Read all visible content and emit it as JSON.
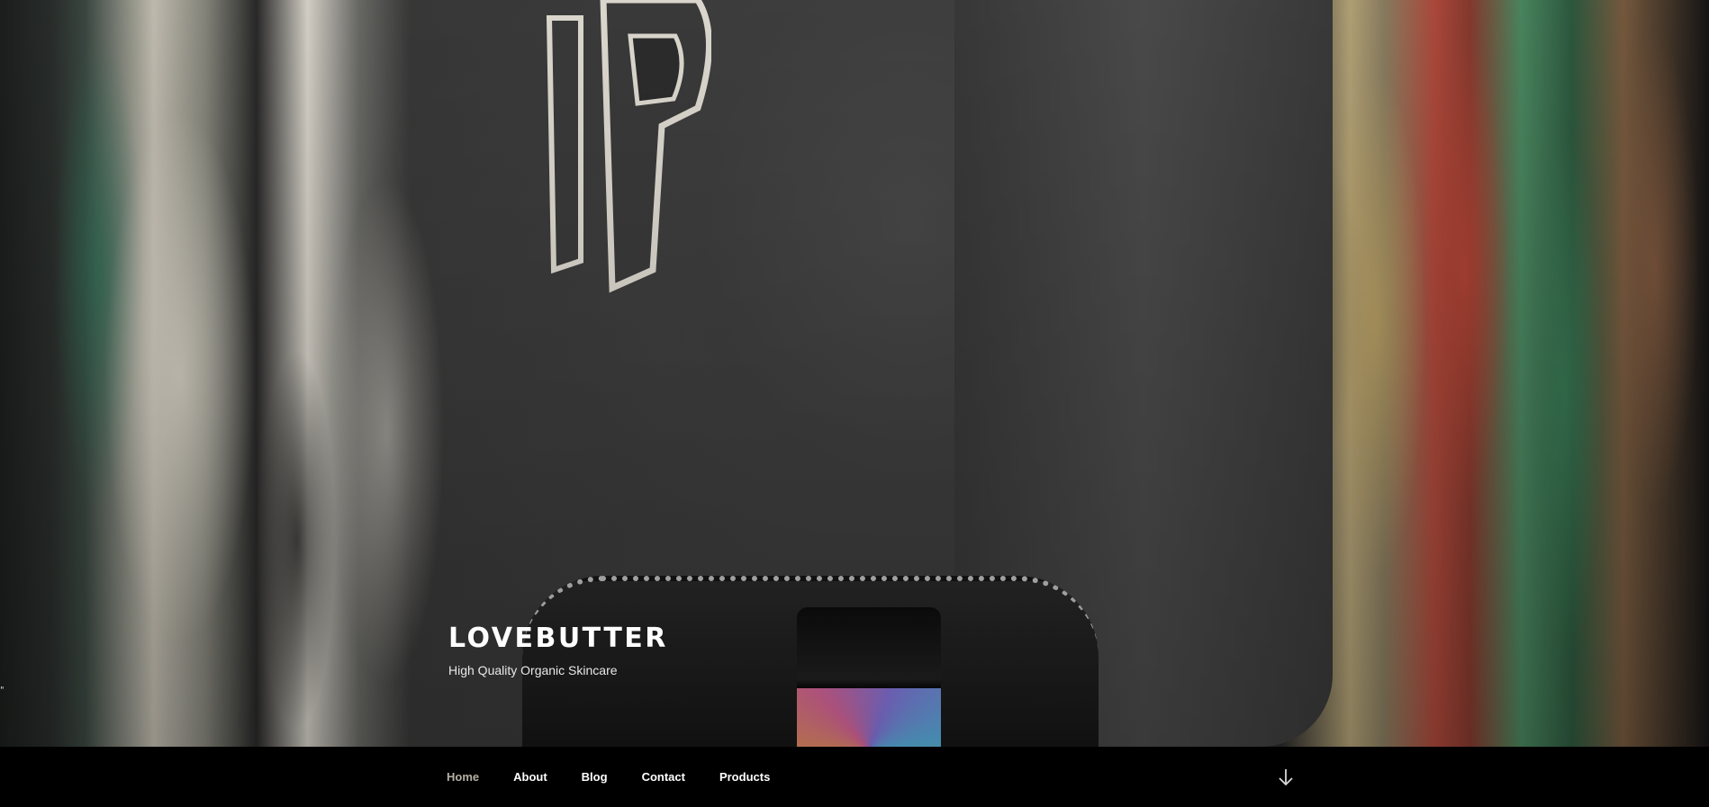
{
  "site": {
    "title": "LOVEBUTTER",
    "tagline": "High Quality Organic Skincare"
  },
  "edge_mark": "\"",
  "navigation": {
    "items": [
      {
        "label": "Home",
        "current": true
      },
      {
        "label": "About",
        "current": false
      },
      {
        "label": "Blog",
        "current": false
      },
      {
        "label": "Contact",
        "current": false
      },
      {
        "label": "Products",
        "current": false
      }
    ],
    "scroll_icon": "arrow-down-icon"
  },
  "colors": {
    "nav_background": "#000000",
    "nav_text": "#ffffff",
    "nav_current": "#b5b0a6",
    "title_text": "#ffffff"
  }
}
